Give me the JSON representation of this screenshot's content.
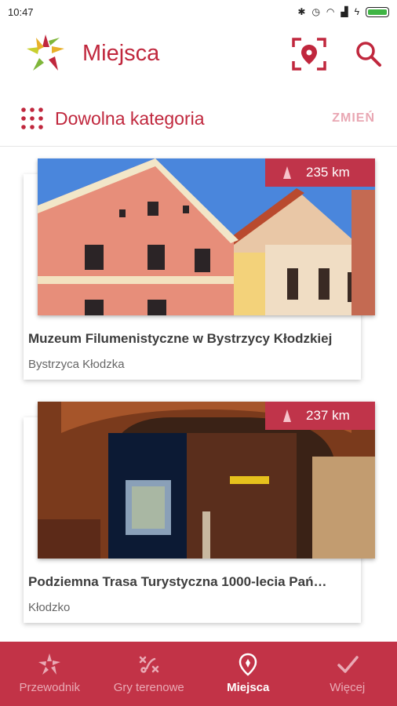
{
  "status": {
    "time": "10:47"
  },
  "header": {
    "title": "Miejsca"
  },
  "category": {
    "label": "Dowolna kategoria",
    "change_label": "ZMIEŃ"
  },
  "places": [
    {
      "title": "Muzeum Filumenistyczne w Bystrzycy Kłodzkiej",
      "town": "Bystrzyca Kłodzka",
      "distance": "235 km"
    },
    {
      "title": "Podziemna Trasa Turystyczna 1000-lecia Pań…",
      "town": "Kłodzko",
      "distance": "237 km"
    }
  ],
  "nav": {
    "items": [
      {
        "label": "Przewodnik",
        "icon": "guide-icon",
        "active": false
      },
      {
        "label": "Gry terenowe",
        "icon": "route-icon",
        "active": false
      },
      {
        "label": "Miejsca",
        "icon": "map-pin-icon",
        "active": true
      },
      {
        "label": "Więcej",
        "icon": "checkmark-icon",
        "active": false
      }
    ]
  },
  "colors": {
    "accent": "#c0273d",
    "nav_bg": "#c23347"
  }
}
